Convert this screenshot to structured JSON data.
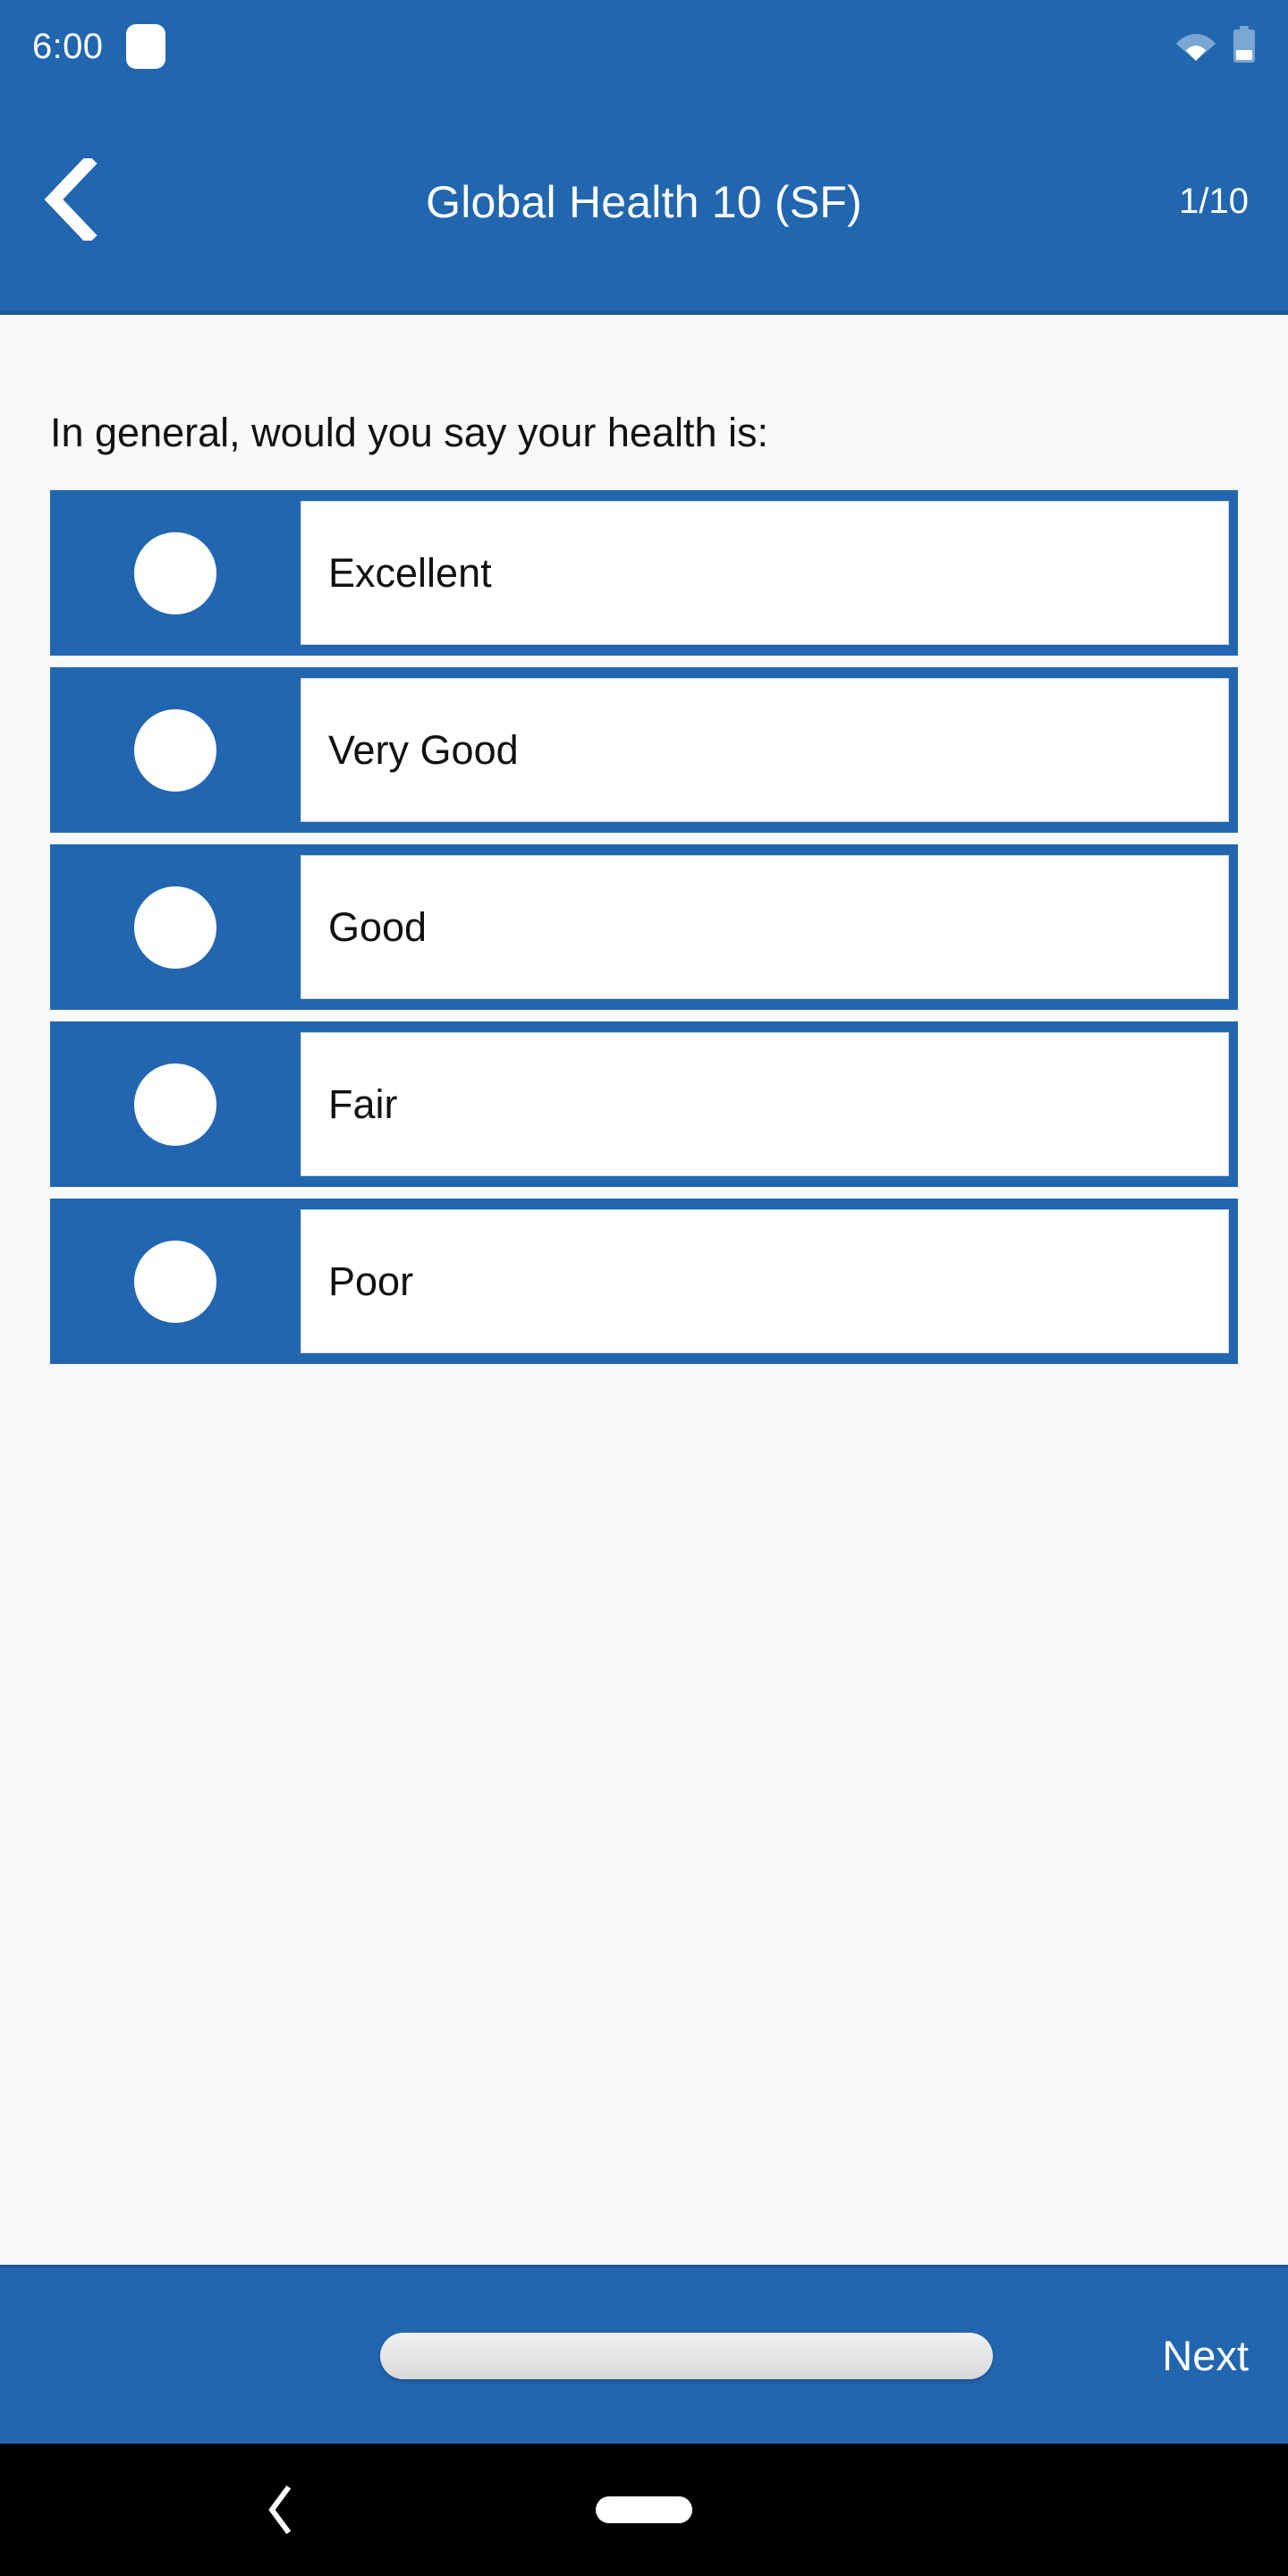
{
  "status_bar": {
    "clock": "6:00",
    "notification_icon": "notification-chip-icon",
    "wifi_icon": "wifi-icon",
    "battery_icon": "battery-low-icon"
  },
  "app_bar": {
    "back_icon": "chevron-left-icon",
    "title": "Global Health 10 (SF)",
    "counter": "1/10"
  },
  "question": {
    "text": "In general, would you say your health is:",
    "options": [
      {
        "label": "Excellent",
        "selected": false
      },
      {
        "label": "Very Good",
        "selected": false
      },
      {
        "label": "Good",
        "selected": false
      },
      {
        "label": "Fair",
        "selected": false
      },
      {
        "label": "Poor",
        "selected": false
      }
    ]
  },
  "bottom_bar": {
    "progress_name": "progress-slider",
    "next_label": "Next"
  },
  "nav_bar": {
    "back_icon": "android-back-icon",
    "home_icon": "android-home-pill-icon"
  },
  "colors": {
    "primary_blue": "#2266b0",
    "primary_blue_dark": "#1b5894",
    "page_background": "#f8f9f9",
    "surface_white": "#ffffff",
    "text_dark": "#111111",
    "nav_black": "#000000"
  }
}
